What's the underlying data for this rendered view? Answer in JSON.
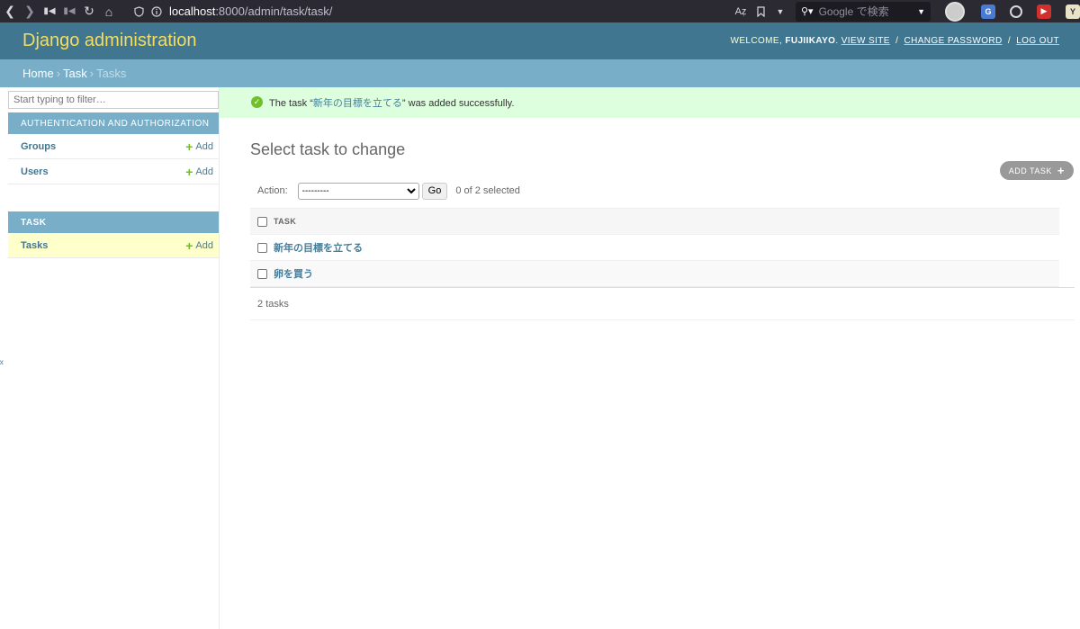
{
  "browser": {
    "url_host": "localhost",
    "url_path": ":8000/admin/task/task/",
    "search_placeholder": "Google で検索"
  },
  "header": {
    "branding": "Django administration",
    "welcome": "WELCOME,",
    "username": "FUJIIKAYO",
    "view_site": "VIEW SITE",
    "change_password": "CHANGE PASSWORD",
    "log_out": "LOG OUT"
  },
  "breadcrumbs": {
    "home": "Home",
    "app": "Task",
    "current": "Tasks",
    "sep": "›"
  },
  "sidebar": {
    "filter_placeholder": "Start typing to filter…",
    "modules": [
      {
        "caption": "Authentication and Authorization",
        "models": [
          {
            "name": "Groups",
            "add": "Add"
          },
          {
            "name": "Users",
            "add": "Add"
          }
        ]
      },
      {
        "caption": "Task",
        "models": [
          {
            "name": "Tasks",
            "add": "Add"
          }
        ]
      }
    ],
    "toggle": "«"
  },
  "message": {
    "prefix": "The task “",
    "object": "新年の目標を立てる",
    "suffix": "” was added successfully."
  },
  "main": {
    "title": "Select task to change",
    "add_button": "ADD TASK",
    "action_label": "Action:",
    "action_selected": "---------",
    "go": "Go",
    "counter": "0 of 2 selected",
    "column_header": "TASK",
    "rows": [
      "新年の目標を立てる",
      "卵を買う"
    ],
    "paginator": "2 tasks"
  },
  "colors": {
    "header": "#417690",
    "branding": "#f5dd5d",
    "breadcrumbs": "#79aec8",
    "success": "#dfd",
    "link": "#447e9b"
  }
}
